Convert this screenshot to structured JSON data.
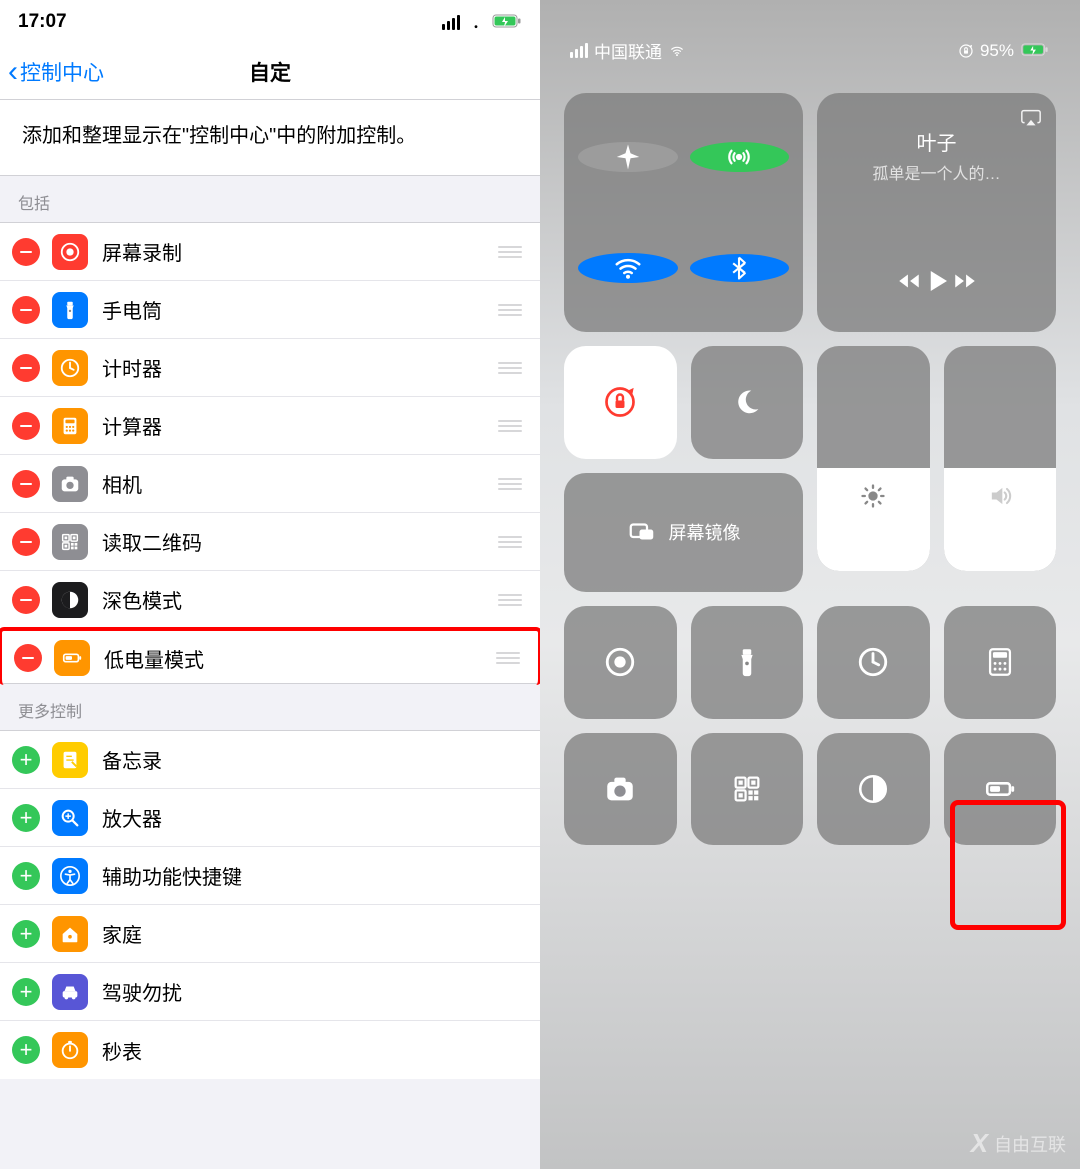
{
  "left": {
    "status": {
      "time": "17:07"
    },
    "nav": {
      "back": "控制中心",
      "title": "自定"
    },
    "description": "添加和整理显示在\"控制中心\"中的附加控制。",
    "section_included": "包括",
    "included": [
      {
        "label": "屏幕录制",
        "icon": "record",
        "bg": "#ff3b30"
      },
      {
        "label": "手电筒",
        "icon": "flashlight",
        "bg": "#007aff"
      },
      {
        "label": "计时器",
        "icon": "timer",
        "bg": "#ff9500"
      },
      {
        "label": "计算器",
        "icon": "calculator",
        "bg": "#ff9500"
      },
      {
        "label": "相机",
        "icon": "camera",
        "bg": "#8e8e93"
      },
      {
        "label": "读取二维码",
        "icon": "qr",
        "bg": "#8e8e93"
      },
      {
        "label": "深色模式",
        "icon": "darkmode",
        "bg": "#1c1c1e"
      },
      {
        "label": "低电量模式",
        "icon": "battery",
        "bg": "#ff9500",
        "highlight": true
      }
    ],
    "section_more": "更多控制",
    "more": [
      {
        "label": "备忘录",
        "icon": "notes",
        "bg": "#ffcc00"
      },
      {
        "label": "放大器",
        "icon": "magnify",
        "bg": "#007aff"
      },
      {
        "label": "辅助功能快捷键",
        "icon": "access",
        "bg": "#007aff"
      },
      {
        "label": "家庭",
        "icon": "home",
        "bg": "#ff9500"
      },
      {
        "label": "驾驶勿扰",
        "icon": "car",
        "bg": "#5856d6"
      },
      {
        "label": "秒表",
        "icon": "stopwatch",
        "bg": "#ff9500"
      }
    ]
  },
  "right": {
    "status": {
      "carrier": "中国联通",
      "battery_pct": "95%"
    },
    "media": {
      "title": "叶子",
      "subtitle": "孤单是一个人的…"
    },
    "mirror_label": "屏幕镜像",
    "brightness_pct": 46,
    "volume_pct": 46,
    "tiles_row1": [
      "record",
      "flashlight",
      "timer",
      "calculator"
    ],
    "tiles_row2": [
      "camera",
      "qr",
      "darkmode",
      "battery"
    ],
    "highlight_tile": "battery"
  },
  "watermark": "自由互联"
}
